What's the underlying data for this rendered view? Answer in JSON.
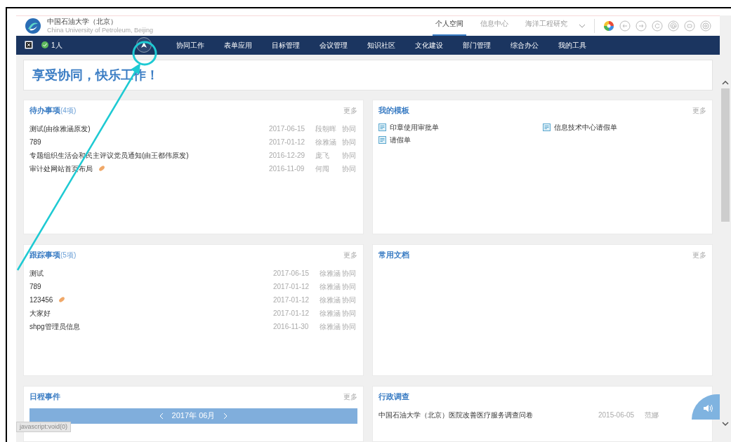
{
  "header": {
    "logo_name": "中国石油大学（北京）",
    "logo_subtitle": "China University of Petroleum, Beijing",
    "top_tabs": [
      {
        "label": "个人空间",
        "selected": true
      },
      {
        "label": "信息中心",
        "selected": false
      },
      {
        "label": "海洋工程研究",
        "selected": false
      }
    ]
  },
  "nav": {
    "user_count": "1人",
    "items": [
      "协同工作",
      "表单应用",
      "目标管理",
      "会议管理",
      "知识社区",
      "文化建设",
      "部门管理",
      "综合办公",
      "我的工具"
    ]
  },
  "welcome": "享受协同，快乐工作！",
  "todo": {
    "title": "待办事项",
    "count": "(4项)",
    "more": "更多",
    "rows": [
      {
        "title": "测试(由徐雅涵原发)",
        "attachment": false,
        "date": "2017-06-15",
        "person": "段朝晖",
        "type": "协同"
      },
      {
        "title": "789",
        "attachment": false,
        "date": "2017-01-12",
        "person": "徐雅涵",
        "type": "协同"
      },
      {
        "title": "专题组织生活会和民主评议党员通知(由王都伟原发)",
        "attachment": false,
        "date": "2016-12-29",
        "person": "庞飞",
        "type": "协同"
      },
      {
        "title": "审计处网站首页布局",
        "attachment": true,
        "date": "2016-11-09",
        "person": "何闯",
        "type": "协同"
      }
    ]
  },
  "templates": {
    "title": "我的模板",
    "more": "更多",
    "items": [
      "印章使用审批单",
      "信息技术中心请假单",
      "请假单"
    ]
  },
  "tracking": {
    "title": "跟踪事项",
    "count": "(5项)",
    "more": "更多",
    "rows": [
      {
        "title": "测试",
        "attachment": false,
        "date": "2017-06-15",
        "person": "徐雅涵",
        "type": "协同"
      },
      {
        "title": "789",
        "attachment": false,
        "date": "2017-01-12",
        "person": "徐雅涵",
        "type": "协同"
      },
      {
        "title": "123456",
        "attachment": true,
        "date": "2017-01-12",
        "person": "徐雅涵",
        "type": "协同"
      },
      {
        "title": "大家好",
        "attachment": false,
        "date": "2017-01-12",
        "person": "徐雅涵",
        "type": "协同"
      },
      {
        "title": "shpg管理员信息",
        "attachment": false,
        "date": "2016-11-30",
        "person": "徐雅涵",
        "type": "协同"
      }
    ]
  },
  "documents": {
    "title": "常用文档",
    "more": "更多"
  },
  "schedule": {
    "title": "日程事件",
    "more": "更多",
    "month": "2017年 06月"
  },
  "survey": {
    "title": "行政调查",
    "rows": [
      {
        "title": "中国石油大学（北京）医院改善医疗服务调查问卷",
        "date": "2015-06-05",
        "person": "范娜"
      }
    ]
  },
  "status_bar": "javascript:void(0)"
}
